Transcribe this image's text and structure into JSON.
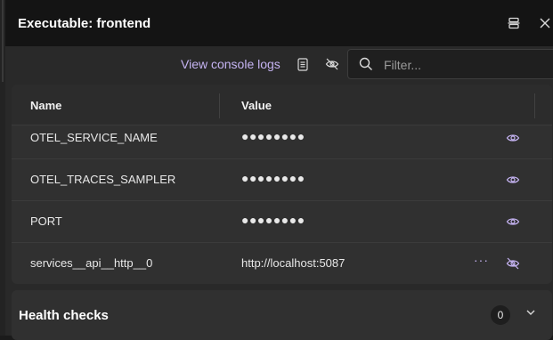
{
  "header": {
    "title": "Executable: frontend",
    "icons": [
      "split-view-icon",
      "close-icon"
    ]
  },
  "toolbar": {
    "console_link": "View console logs",
    "filter_placeholder": "Filter...",
    "icons": [
      "document-icon",
      "eye-slash-icon",
      "search-icon"
    ]
  },
  "grid": {
    "columns": [
      "Name",
      "Value"
    ],
    "rows": [
      {
        "name": "OTEL_SERVICE_NAME",
        "value": "●●●●●●●●",
        "masked": true
      },
      {
        "name": "OTEL_TRACES_SAMPLER",
        "value": "●●●●●●●●",
        "masked": true
      },
      {
        "name": "PORT",
        "value": "●●●●●●●●",
        "masked": true
      },
      {
        "name": "services__api__http__0",
        "value": "http://localhost:5087",
        "masked": false,
        "more_label": "···"
      }
    ]
  },
  "health": {
    "title": "Health checks",
    "count": "0"
  },
  "colors": {
    "accent": "#c5b3f2",
    "header_bg": "#141414",
    "panel_bg": "#292929",
    "card_bg": "#303030"
  }
}
